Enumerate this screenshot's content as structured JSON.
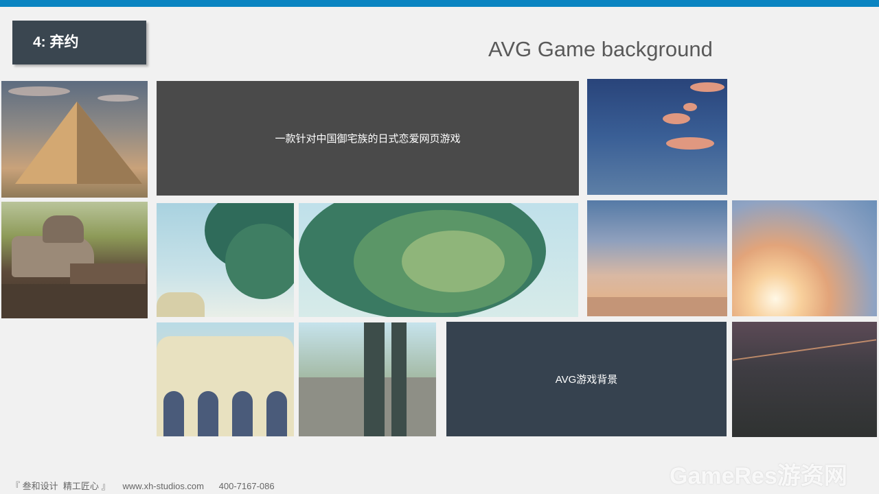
{
  "slide": {
    "section_title": "4: 弃约",
    "main_title": "AVG Game background",
    "dark_tile_text": "一款针对中国御宅族的日式恋爱网页游戏",
    "slate_tile_text": "AVG游戏背景",
    "footer": "『 叁和设计  精工匠心 』     www.xh-studios.com      400-7167-086",
    "watermark": "GameRes游资网"
  },
  "colors": {
    "accent_bar": "#0a84c1",
    "title_box": "#3a4650",
    "dark_tile": "#4a4a4a",
    "slate_tile": "#36424f"
  }
}
